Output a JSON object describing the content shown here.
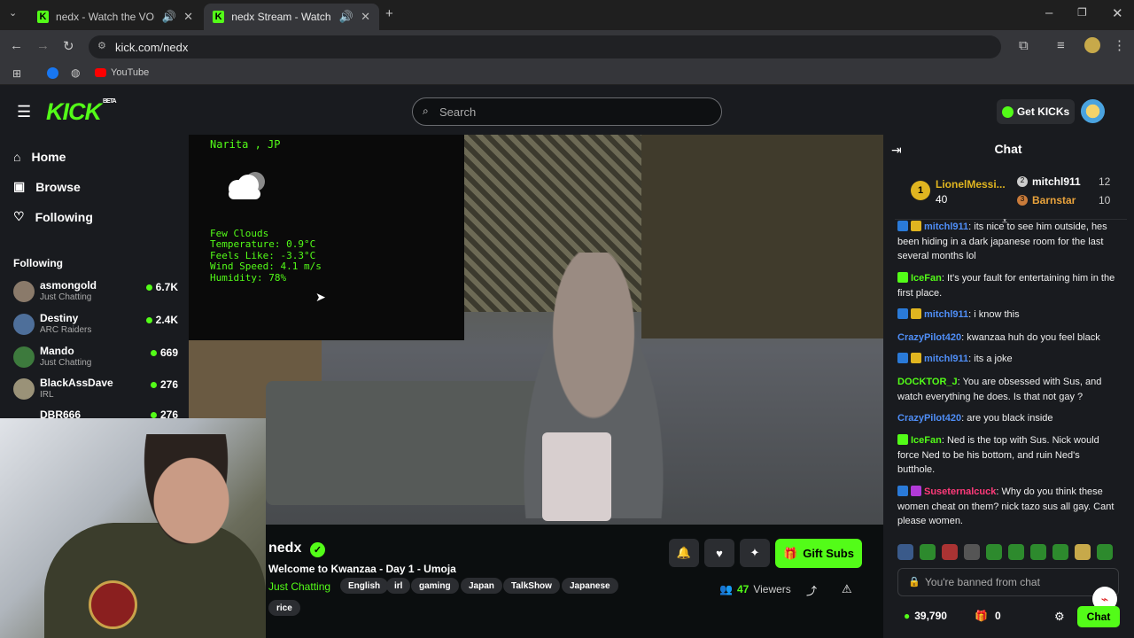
{
  "browser": {
    "tabs": [
      {
        "title": "nedx - Watch the VOD on K"
      },
      {
        "title": "nedx Stream - Watch Live o"
      }
    ],
    "new_tab": "+",
    "url": "kick.com/nedx",
    "bookmarks": [
      {
        "label": "YouTube"
      }
    ]
  },
  "header": {
    "logo": "KICK",
    "logo_badge": "BETA",
    "search_placeholder": "Search",
    "get_kicks": "Get KICKs"
  },
  "sidebar": {
    "nav": [
      {
        "label": "Home"
      },
      {
        "label": "Browse"
      },
      {
        "label": "Following"
      }
    ],
    "following_heading": "Following",
    "channels": [
      {
        "name": "asmongold",
        "category": "Just Chatting",
        "viewers": "6.7K"
      },
      {
        "name": "Destiny",
        "category": "ARC Raiders",
        "viewers": "2.4K"
      },
      {
        "name": "Mando",
        "category": "Just Chatting",
        "viewers": "669"
      },
      {
        "name": "BlackAssDave",
        "category": "IRL",
        "viewers": "276"
      },
      {
        "name": "DBR666",
        "category": "",
        "viewers": "276"
      }
    ]
  },
  "weather": {
    "location": "Narita , JP",
    "condition": "Few Clouds",
    "temperature": "Temperature: 0.9°C",
    "feels_like": "Feels Like: -3.3°C",
    "wind": "Wind Speed: 4.1 m/s",
    "humidity": "Humidity: 78%"
  },
  "stream": {
    "channel": "nedx",
    "title": "Welcome to Kwanzaa - Day 1 - Umoja",
    "category": "Just Chatting",
    "tags": [
      "English",
      "irl",
      "gaming",
      "Japan",
      "TalkShow",
      "Japanese",
      "rice"
    ],
    "gift_subs": "Gift Subs",
    "viewer_count": "47",
    "viewers_label": "Viewers"
  },
  "chat": {
    "title": "Chat",
    "leaderboard": [
      {
        "rank": "1",
        "name": "LionelMessi...",
        "count": "40"
      },
      {
        "rank": "2",
        "name": "mitchl911",
        "count": "12"
      },
      {
        "rank": "3",
        "name": "Barnstar",
        "count": "10"
      }
    ],
    "messages": [
      {
        "user": "mitchl911",
        "color": "#4f8ef7",
        "text": "its nice to see him outside, hes been hiding in a dark japanese room for the last several months lol"
      },
      {
        "user": "IceFan",
        "color": "#53fc18",
        "text": "It's your fault for entertaining him in the first place."
      },
      {
        "user": "mitchl911",
        "color": "#4f8ef7",
        "text": "i know this"
      },
      {
        "user": "CrazyPilot420",
        "color": "#4f8ef7",
        "text": "kwanzaa huh do you feel black"
      },
      {
        "user": "mitchl911",
        "color": "#4f8ef7",
        "text": "its a joke"
      },
      {
        "user": "DOCKTOR_J",
        "color": "#53fc18",
        "text": "You are obsessed with Sus, and watch everything he does. Is that not gay ?"
      },
      {
        "user": "CrazyPilot420",
        "color": "#4f8ef7",
        "text": "are you black inside"
      },
      {
        "user": "IceFan",
        "color": "#53fc18",
        "text": "Ned is the top with Sus. Nick would force Ned to be his bottom, and ruin Ned's butthole."
      },
      {
        "user": "Suseternalcuck",
        "color": "#ff3a7a",
        "text": "Why do you think these women cheat on them? nick tazo sus all gay. Cant please women."
      }
    ],
    "banned_placeholder": "You're banned from chat",
    "kicks_balance": "39,790",
    "gift_count": "0",
    "send_label": "Chat"
  }
}
